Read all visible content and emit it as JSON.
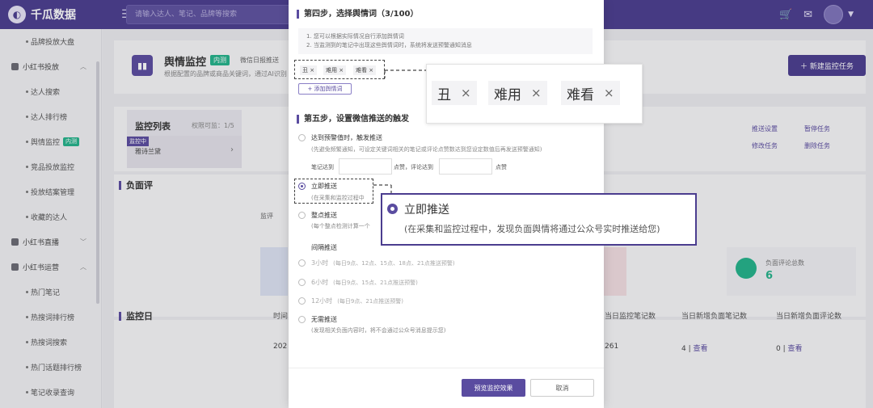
{
  "topbar": {
    "logo_text": "千瓜数据",
    "search_placeholder": "请输入达人、笔记、品牌等搜索"
  },
  "sidebar": {
    "items": [
      {
        "label": "品牌投放大盘",
        "type": "item"
      },
      {
        "label": "小红书投放",
        "type": "group"
      },
      {
        "label": "达人搜索",
        "type": "item"
      },
      {
        "label": "达人排行榜",
        "type": "item"
      },
      {
        "label": "舆情监控",
        "type": "item",
        "badge": "内测"
      },
      {
        "label": "竞品投放监控",
        "type": "item"
      },
      {
        "label": "投放结案管理",
        "type": "item"
      },
      {
        "label": "收藏的达人",
        "type": "item"
      },
      {
        "label": "小红书直播",
        "type": "group"
      },
      {
        "label": "小红书运营",
        "type": "group"
      },
      {
        "label": "热门笔记",
        "type": "item"
      },
      {
        "label": "热搜词排行榜",
        "type": "item"
      },
      {
        "label": "热搜词搜索",
        "type": "item"
      },
      {
        "label": "热门话题排行榜",
        "type": "item"
      },
      {
        "label": "笔记收录查询",
        "type": "item"
      }
    ]
  },
  "page": {
    "title": "舆情监控",
    "title_badge": "内测",
    "link_text": "微信日报推送",
    "description": "根据配置的品牌或商品关键词，通过AI识别",
    "new_button": "新建监控任务",
    "list_title": "监控列表",
    "list_meta": "权限可监：1/5",
    "list_item_tag": "监控中",
    "list_item_name": "雅诗兰黛",
    "actions": [
      "推送设置",
      "暂停任务",
      "修改任务",
      "删除任务"
    ],
    "section_negative": "负面评",
    "section_negative_sub": "监评",
    "stat_label": "负面评论总数",
    "stat_value": "6",
    "section_monitor": "监控日",
    "col_time": "时间",
    "col_a": "当日监控笔记数",
    "col_b": "当日新增负面笔记数",
    "col_c": "当日新增负面评论数",
    "row_time": "202",
    "row_a": "261",
    "row_b_num": "4",
    "row_b_link": "查看",
    "row_c_num": "0",
    "row_c_link": "查看",
    "row_sep": "|"
  },
  "modal": {
    "step4_title": "第四步，选择舆情词（3/100）",
    "tips": [
      "1. 您可以根据实际情况自行添加舆情词",
      "2. 当监测到的笔记中出现这些舆情词时，系统将发送预警通知消息"
    ],
    "keywords": [
      "丑",
      "难用",
      "难看"
    ],
    "remove_glyph": "×",
    "add_keyword": "+ 添加舆情词",
    "step5_title": "第五步，设置微信推送的触发",
    "opt_threshold": "达到预警值时，触发推送",
    "opt_threshold_desc": "(先避免频繁通知，可设定关键词相关的笔记或评论点赞数达到您设定数值后再发送预警通知)",
    "threshold_note_label": "笔记达到",
    "threshold_mid_label": "点赞，评论达到",
    "threshold_end_label": "点赞",
    "opt_instant": "立即推送",
    "opt_instant_desc_short": "(在采集和监控过程中",
    "opt_hourly": "整点推送",
    "opt_hourly_desc": "(每个整点检测计算一个",
    "interval_label": "间隔推送",
    "opt_3h": "3小时",
    "opt_3h_desc": "(每日9点、12点、15点、18点、21点推送预警)",
    "opt_6h": "6小时",
    "opt_6h_desc": "(每日9点、15点、21点推送预警)",
    "opt_12h": "12小时",
    "opt_12h_desc": "(每日9点、21点推送预警)",
    "opt_none": "无需推送",
    "opt_none_desc": "(发现相关负面内容时，将不会通过公众号消息提示您)",
    "preview_button": "预览监控效果",
    "cancel_button": "取消"
  },
  "callout_keywords": [
    "丑",
    "难用",
    "难看"
  ],
  "callout_instant": {
    "title": "立即推送",
    "desc": "(在采集和监控过程中，发现负面舆情将通过公众号实时推送给您)"
  }
}
